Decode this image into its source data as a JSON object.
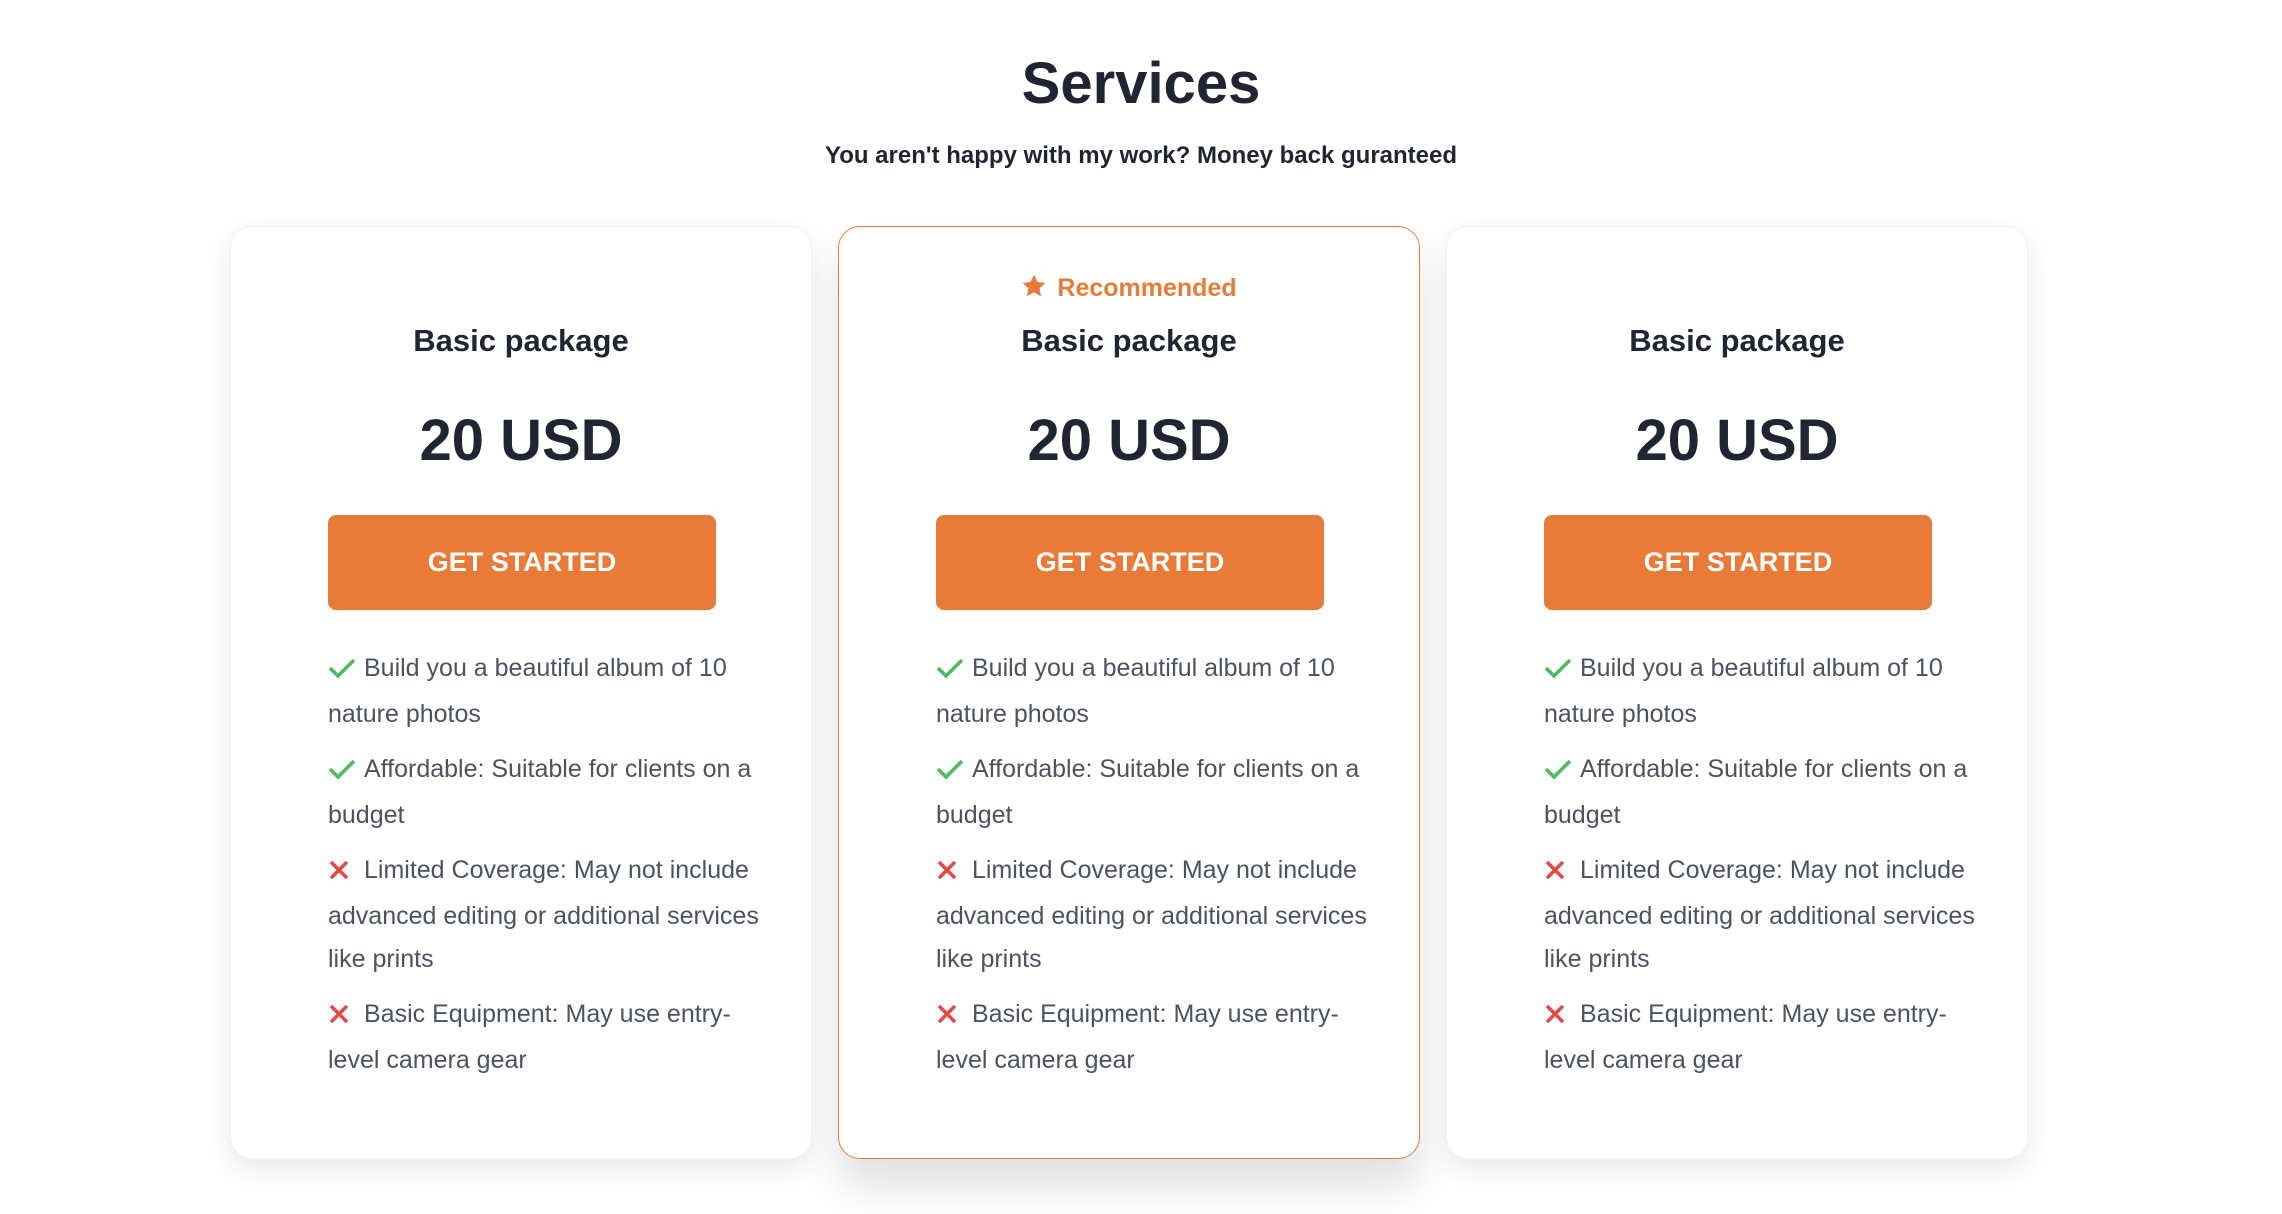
{
  "header": {
    "title": "Services",
    "subtitle": "You aren't happy with my work? Money back guranteed"
  },
  "colors": {
    "accent": "#e87b38",
    "check": "#4cbb5e",
    "cross": "#e04a3f"
  },
  "cards": [
    {
      "recommended": false,
      "name": "Basic package",
      "price": "20 USD",
      "button": "GET STARTED",
      "features": [
        {
          "icon": "check-icon",
          "text": "Build you a beautiful album of 10 nature photos"
        },
        {
          "icon": "check-icon",
          "text": "Affordable: Suitable for clients on a budget"
        },
        {
          "icon": "cross-icon",
          "text": "Limited Coverage: May not include advanced editing or additional services like prints"
        },
        {
          "icon": "cross-icon",
          "text": "Basic Equipment: May use entry-level camera gear"
        }
      ]
    },
    {
      "recommended": true,
      "badge": "Recommended",
      "name": "Basic package",
      "price": "20 USD",
      "button": "GET STARTED",
      "features": [
        {
          "icon": "check-icon",
          "text": "Build you a beautiful album of 10 nature photos"
        },
        {
          "icon": "check-icon",
          "text": "Affordable: Suitable for clients on a budget"
        },
        {
          "icon": "cross-icon",
          "text": "Limited Coverage: May not include advanced editing or additional services like prints"
        },
        {
          "icon": "cross-icon",
          "text": "Basic Equipment: May use entry-level camera gear"
        }
      ]
    },
    {
      "recommended": false,
      "name": "Basic package",
      "price": "20 USD",
      "button": "GET STARTED",
      "features": [
        {
          "icon": "check-icon",
          "text": "Build you a beautiful album of 10 nature photos"
        },
        {
          "icon": "check-icon",
          "text": "Affordable: Suitable for clients on a budget"
        },
        {
          "icon": "cross-icon",
          "text": "Limited Coverage: May not include advanced editing or additional services like prints"
        },
        {
          "icon": "cross-icon",
          "text": "Basic Equipment: May use entry-level camera gear"
        }
      ]
    }
  ]
}
